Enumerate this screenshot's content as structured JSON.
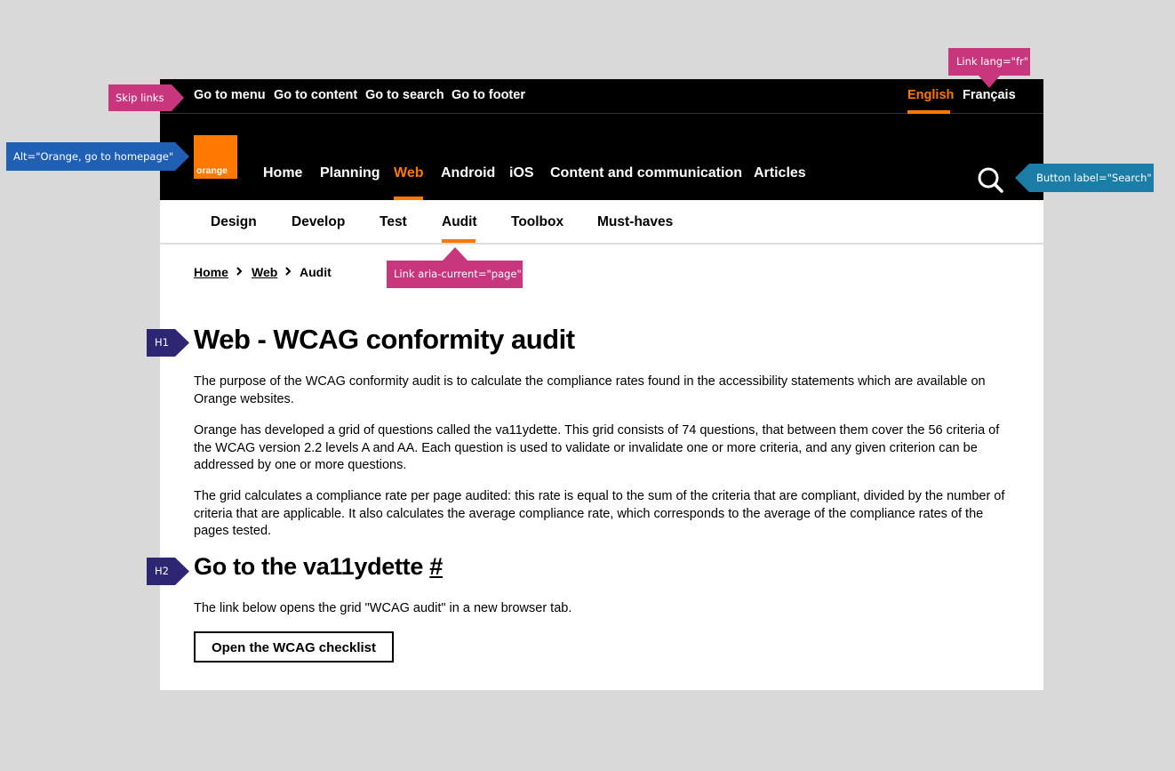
{
  "skip_links": [
    "Go to menu",
    "Go to content",
    "Go to search",
    "Go to footer"
  ],
  "languages": {
    "english": "English",
    "french": "Français"
  },
  "logo": {
    "text": "orange",
    "alt": "Orange, go to homepage"
  },
  "main_nav": [
    "Home",
    "Planning",
    "Web",
    "Android",
    "iOS",
    "Content and communication",
    "Articles"
  ],
  "main_nav_active": "Web",
  "sub_nav": [
    "Design",
    "Develop",
    "Test",
    "Audit",
    "Toolbox",
    "Must-haves"
  ],
  "sub_nav_active": "Audit",
  "breadcrumb": [
    "Home",
    "Web",
    "Audit"
  ],
  "content": {
    "h1": "Web - WCAG conformity audit",
    "p1": "The purpose of the WCAG conformity audit is to calculate the compliance rates found in the accessibility statements which are available on Orange websites.",
    "p2": "Orange has developed a grid of questions called the va11ydette. This grid consists of 74 questions, that between them cover the 56 criteria of the WCAG version 2.2 levels A and AA. Each question is used to validate or invalidate one or more criteria, and any given criterion can be addressed by one or more questions.",
    "p3": "The grid calculates a compliance rate per page audited: this rate is equal to the sum of the criteria that are compliant, divided by the number of criteria that are applicable. It also calculates the average compliance rate, which corresponds to the average of the compliance rates of the pages tested.",
    "h2": "Go to the va11ydette ",
    "h2_anchor": "#",
    "p4": "The link below opens the grid \"WCAG audit\" in a new browser tab.",
    "button": "Open the WCAG checklist"
  },
  "annotations": {
    "skip_links": "Skip links",
    "logo_alt": "Alt=\"Orange, go to homepage\"",
    "lang_fr": "Link lang=\"fr\"",
    "search": "Button label=\"Search\"",
    "aria_current": "Link aria-current=\"page\"",
    "h1": "H1",
    "h2": "H2"
  },
  "colors": {
    "brand": "#ff7900",
    "annotation_pink": "#c8367e",
    "annotation_blue": "#1f5fb4",
    "annotation_teal": "#1c7ea6",
    "annotation_purple": "#2d2673"
  }
}
